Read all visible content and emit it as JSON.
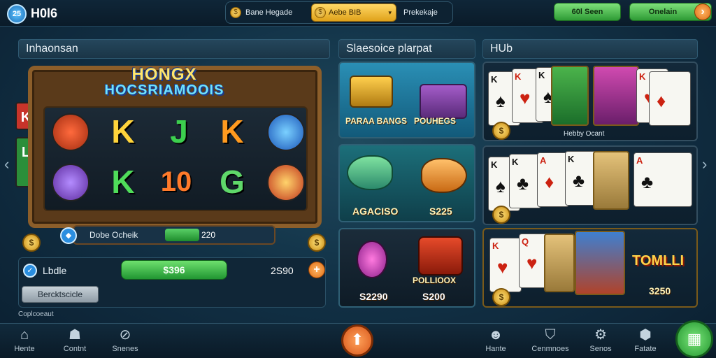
{
  "header": {
    "logo_badge": "25",
    "logo_text": "H0l6",
    "bonus_label": "Bane Hegade",
    "gold_pill_label": "Aebe BIB",
    "gold_pill_arrow": "▾",
    "profile_label": "Prekekaje",
    "green_button_label": "60l Seen",
    "online_button_label": "Onelain"
  },
  "sections": {
    "left_title": "Inhaonsan",
    "middle_title": "Slaesoice plarpat",
    "right_title": "HUb"
  },
  "slot": {
    "title_line1": "HONGX",
    "title_line2": "HOCSRIAMOOIS",
    "row1": [
      "K",
      "J",
      "K"
    ],
    "row2": [
      "K",
      "10",
      "G"
    ],
    "progress_label": "Dobe Ocheik",
    "progress_value": "220",
    "progress_fraction": 0.35
  },
  "bottom_panel": {
    "label": "Lbdle",
    "green_value": "$396",
    "amount": "2S90",
    "secondary_button": "Bercktscicle",
    "footer_text": "Coplcoeaut"
  },
  "tiles": {
    "treasure_left_label": "PARAA BANGS",
    "treasure_right_label": "POUHEGS",
    "fish_left_label": "AGACISO",
    "fish_right_price": "S225",
    "gem_price": "S2290",
    "pirate_label": "POLLIOOX",
    "pirate_price": "S200"
  },
  "hub": {
    "row1_caption": "Hebby Ocant",
    "row3_logo": "TOMLLI",
    "row3_price": "3250"
  },
  "bottom_nav": {
    "items_left": [
      {
        "label": "Hente",
        "icon": "home-icon"
      },
      {
        "label": "Contnt",
        "icon": "people-icon"
      },
      {
        "label": "Snenes",
        "icon": "compass-icon"
      }
    ],
    "items_right": [
      {
        "label": "Hante",
        "icon": "user-icon"
      },
      {
        "label": "Cenmnoes",
        "icon": "shield-icon"
      },
      {
        "label": "Senos",
        "icon": "gear-icon"
      },
      {
        "label": "Fatate",
        "icon": "gamepad-icon"
      }
    ]
  },
  "colors": {
    "accent_green": "#2e9b35",
    "accent_gold": "#e0a21a",
    "accent_orange": "#e06c12",
    "background": "#123247"
  }
}
